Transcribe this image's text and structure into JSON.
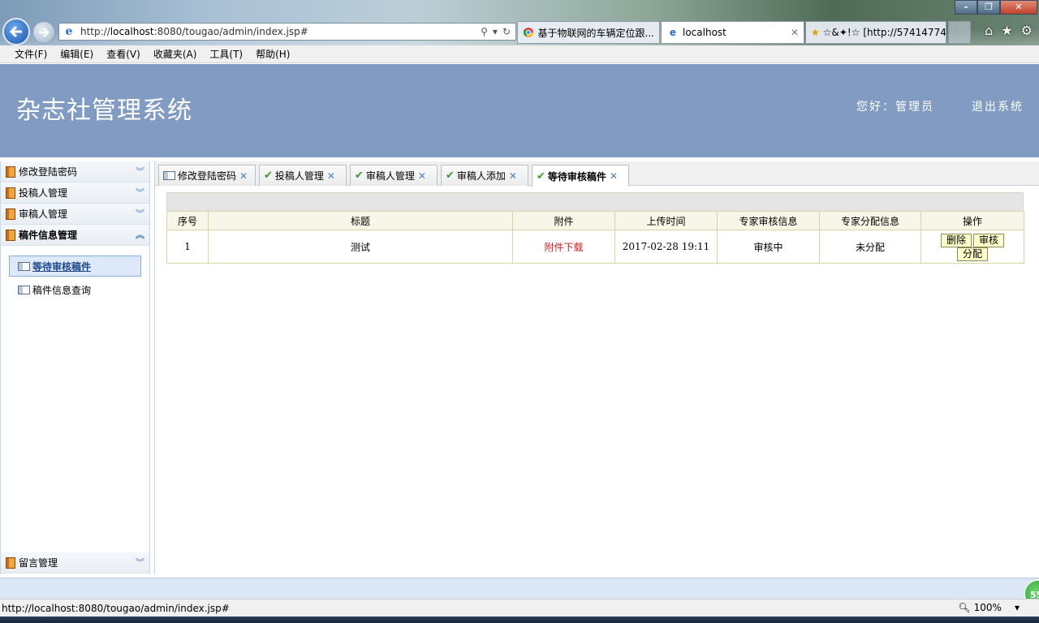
{
  "browser": {
    "window_controls": {
      "minimize": "–",
      "restore": "❐",
      "close": "✕"
    },
    "address": {
      "prefix": "http://",
      "host": "localhost",
      "rest": ":8080/tougao/admin/index.jsp#"
    },
    "tabs": [
      {
        "label": "基于物联网的车辆定位跟...",
        "icon": "chrome-icon"
      },
      {
        "label": "localhost",
        "icon": "ie-icon",
        "active": true
      },
      {
        "label": "☆&✦!☆ [http://57414774...",
        "icon": "star-icon"
      }
    ],
    "menu": [
      "文件(F)",
      "编辑(E)",
      "查看(V)",
      "收藏夹(A)",
      "工具(T)",
      "帮助(H)"
    ],
    "status_url": "http://localhost:8080/tougao/admin/index.jsp#",
    "zoom": "100%",
    "badge": "55"
  },
  "header": {
    "title": "杂志社管理系统",
    "greeting": "您好：管理员",
    "logout": "退出系统"
  },
  "sidebar": {
    "groups": [
      {
        "label": "修改登陆密码"
      },
      {
        "label": "投稿人管理"
      },
      {
        "label": "审稿人管理"
      },
      {
        "label": "稿件信息管理",
        "open": true
      }
    ],
    "items": [
      {
        "label": "等待审核稿件",
        "active": true
      },
      {
        "label": "稿件信息查询"
      }
    ],
    "bottom_group": {
      "label": "留言管理"
    }
  },
  "tabs": [
    {
      "label": "修改登陆密码",
      "icon": "card-icon"
    },
    {
      "label": "投稿人管理",
      "icon": "check-icon"
    },
    {
      "label": "审稿人管理",
      "icon": "check-icon"
    },
    {
      "label": "审稿人添加",
      "icon": "check-icon"
    },
    {
      "label": "等待审核稿件",
      "icon": "check-icon",
      "active": true
    }
  ],
  "grid": {
    "columns": [
      "序号",
      "标题",
      "附件",
      "上传时间",
      "专家审核信息",
      "专家分配信息",
      "操作"
    ],
    "rows": [
      {
        "no": "1",
        "title": "测试",
        "attachment": "附件下载",
        "time": "2017-02-28 19:11",
        "review": "审核中",
        "assign": "未分配",
        "actions": {
          "delete": "删除",
          "audit": "审核",
          "assign": "分配"
        }
      }
    ]
  },
  "colors": {
    "header_bg": "#819bc2",
    "download_link": "#cc1b1b",
    "button_bg": "#ffffcc"
  }
}
